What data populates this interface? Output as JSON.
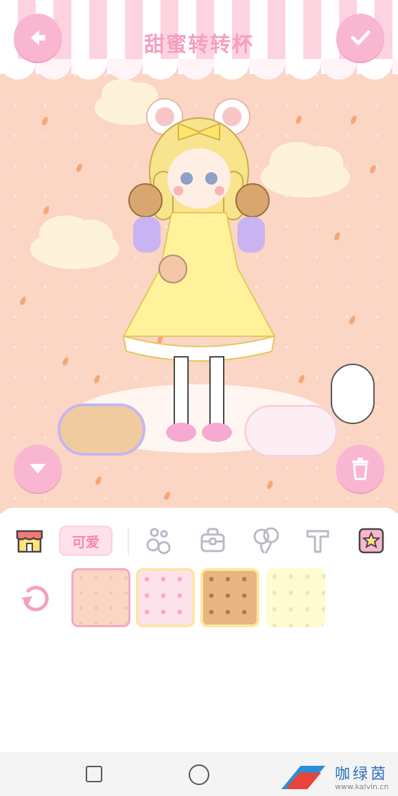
{
  "header": {
    "title": "甜蜜转转杯",
    "back_icon": "arrow-left-icon",
    "confirm_icon": "check-icon"
  },
  "scene": {
    "collapse_icon": "chevron-down-icon",
    "delete_icon": "trash-icon",
    "colors": {
      "background": "#fbd6c4",
      "button": "#f9b6d1",
      "title": "#f59fc1"
    }
  },
  "panel": {
    "tabs": [
      {
        "id": "shop",
        "icon": "shop-icon"
      },
      {
        "id": "cute",
        "label": "可爱",
        "selected": true
      },
      {
        "id": "decor",
        "icon": "flower-decoration-icon"
      },
      {
        "id": "bag",
        "icon": "bag-icon"
      },
      {
        "id": "balloon",
        "icon": "balloon-icon"
      },
      {
        "id": "text",
        "icon": "text-icon"
      },
      {
        "id": "favorite",
        "icon": "star-icon"
      }
    ],
    "reset_icon": "reset-icon",
    "swatches": [
      {
        "name": "peach-carrot",
        "selected": true
      },
      {
        "name": "pink-bunny"
      },
      {
        "name": "brown-bear"
      },
      {
        "name": "cream-flower"
      }
    ]
  },
  "navbar": {
    "watermark_name": "咖绿茵",
    "watermark_url": "www.kalvin.cn"
  }
}
